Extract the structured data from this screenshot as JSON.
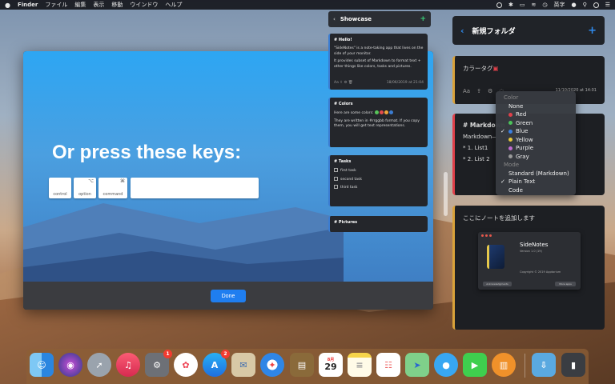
{
  "menubar": {
    "app": "Finder",
    "items": [
      "ファイル",
      "編集",
      "表示",
      "移動",
      "ウインドウ",
      "ヘルプ"
    ],
    "input_source": "英字"
  },
  "main_window": {
    "headline": "Or press these keys:",
    "keys": [
      {
        "label": "control",
        "symbol": ""
      },
      {
        "label": "option",
        "symbol": "⌥"
      },
      {
        "label": "command",
        "symbol": "⌘"
      }
    ],
    "done_label": "Done",
    "showcase": {
      "title": "Showcase",
      "notes": [
        {
          "title": "# Hello!",
          "body": "\"SideNotes\" is a note-taking app that lives on the side of your monitor.",
          "body2": "It provides subset of Markdown to format text + other things like colors, tasks and pictures.",
          "timestamp": "18/06/2019 at 21:04"
        },
        {
          "title": "# Colors",
          "body": "Here are some colors:",
          "body2": "They are written in #rrggbb format. If you copy them, you will get text representations.",
          "dot_colors": [
            "#57c35a",
            "#e34a4a",
            "#f0a53a",
            "#3b7cd1"
          ]
        },
        {
          "title": "# Tasks",
          "tasks": [
            "first task",
            "second task",
            "third task"
          ]
        },
        {
          "title": "# Pictures"
        }
      ]
    }
  },
  "side_panel": {
    "folder_title": "新規フォルダ",
    "card1": {
      "text": "カラータグ",
      "timestamp": "11/10/2020 at 14:01",
      "format_label": "Aa"
    },
    "card2": {
      "title": "# Markdown",
      "line1": "Markdown—",
      "line2": "* 1. List1",
      "line3": "* 2. List 2"
    },
    "card3": {
      "text": "ここにノートを追加します"
    }
  },
  "color_menu": {
    "color_header": "Color",
    "colors": [
      {
        "label": "None",
        "color": "",
        "checked": false
      },
      {
        "label": "Red",
        "color": "#e0404a",
        "checked": false
      },
      {
        "label": "Green",
        "color": "#4cc35a",
        "checked": false
      },
      {
        "label": "Blue",
        "color": "#3a7fe0",
        "checked": true
      },
      {
        "label": "Yellow",
        "color": "#e8c83a",
        "checked": false
      },
      {
        "label": "Purple",
        "color": "#c06ad0",
        "checked": false
      },
      {
        "label": "Gray",
        "color": "#9a9a9a",
        "checked": false
      }
    ],
    "mode_header": "Mode",
    "modes": [
      {
        "label": "Standard (Markdown)",
        "checked": false
      },
      {
        "label": "Plain Text",
        "checked": true
      },
      {
        "label": "Code",
        "checked": false
      }
    ]
  },
  "about": {
    "app_name": "SideNotes",
    "version": "Version 1.0 (19)",
    "copyright": "Copyright © 2019 Apptorium",
    "btn_left": "Acknowledgments",
    "btn_right": "More apps"
  },
  "dock": {
    "badges": {
      "system_prefs": "1",
      "app_store": "2"
    },
    "calendar_day": "29",
    "calendar_month": "8月"
  }
}
